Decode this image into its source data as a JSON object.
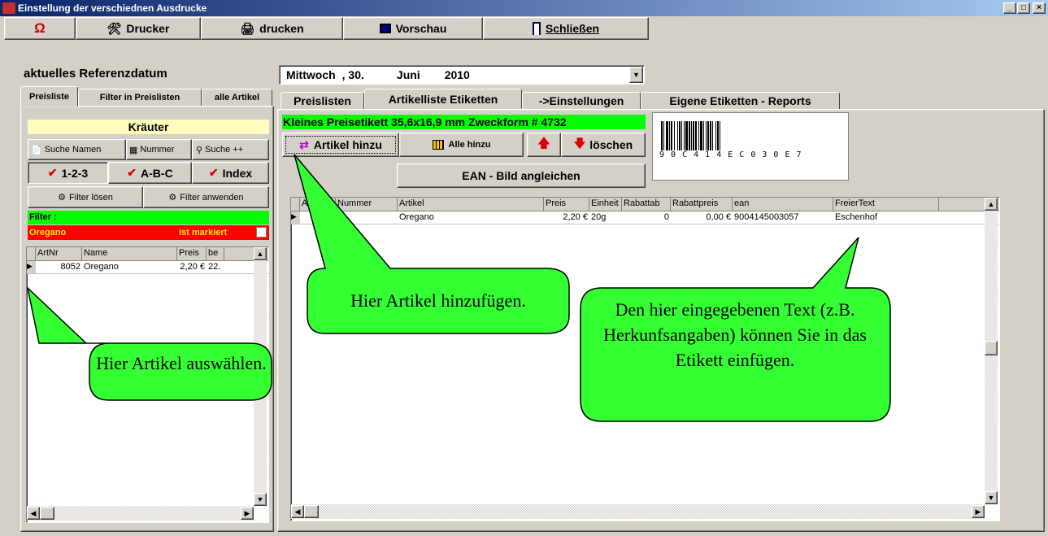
{
  "window": {
    "title": "Einstellung der verschiednen Ausdrucke"
  },
  "toolbar": {
    "refresh_glyph": "Ω",
    "printer": "Drucker",
    "print": "drucken",
    "preview": "Vorschau",
    "close": "Schließen"
  },
  "refdate": {
    "label": "aktuelles Referenzdatum",
    "weekday": "Mittwoch",
    "day": ", 30.",
    "month": "Juni",
    "year": "2010"
  },
  "left_tabs": [
    "Preisliste",
    "Filter in Preislisten",
    "alle Artikel"
  ],
  "left": {
    "category": "Kräuter",
    "search_name": "Suche Namen",
    "search_number": "Nummer",
    "search_plus": "Suche ++",
    "sort_num": "1-2-3",
    "sort_alpha": "A-B-C",
    "sort_index": "Index",
    "filter_clear": "Filter lösen",
    "filter_apply": "Filter anwenden",
    "filter_label": "Filter :",
    "filter_value": "Oregano",
    "marked_label": "ist markiert",
    "columns": [
      "ArtNr",
      "Name",
      "Preis",
      "be"
    ],
    "rows": [
      [
        "8052",
        "Oregano",
        "2,20 €",
        "22."
      ]
    ]
  },
  "right_tabs": [
    "Preislisten",
    "Artikelliste Etiketten",
    "->Einstellungen",
    "Eigene Etiketten - Reports"
  ],
  "label": {
    "format": "Kleines Preisetikett 35,6x16,9 mm Zweckform # 4732",
    "barcode_digits": "9 0 C 4 1 4 E  C 0 3 0 E 7",
    "add_article": "Artikel hinzu",
    "add_all": "Alle hinzu",
    "delete": "löschen",
    "ean_adjust": "EAN - Bild angleichen"
  },
  "table": {
    "columns": [
      "ArtNr",
      "Nummer",
      "Artikel",
      "Preis",
      "Einheit",
      "Rabattab",
      "Rabattpreis",
      "ean",
      "FreierText"
    ],
    "rows": [
      [
        "",
        "",
        "Oregano",
        "2,20 €",
        "20g",
        "0",
        "0,00 €",
        "9004145003057",
        "Eschenhof"
      ]
    ]
  },
  "callouts": {
    "select": "Hier Artikel auswählen.",
    "add": "Hier Artikel hinzufügen.",
    "freetext": "Den hier eingegebenen Text (z.B. Herkunfsangaben) können Sie in das Etikett einfügen."
  },
  "colors": {
    "green": "#00ff00",
    "red": "#ff0000",
    "yellow": "#ffffc0",
    "callout": "#33ff33"
  }
}
